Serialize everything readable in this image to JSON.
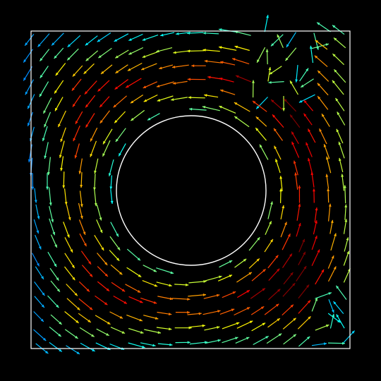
{
  "figure": {
    "kind": "vector field (quiver) plot",
    "background": "#000000",
    "boundary_color": "#ffffff",
    "colormap": "jet",
    "flow_direction": "counter-clockwise",
    "obstacle": "circle",
    "domain": "square"
  }
}
